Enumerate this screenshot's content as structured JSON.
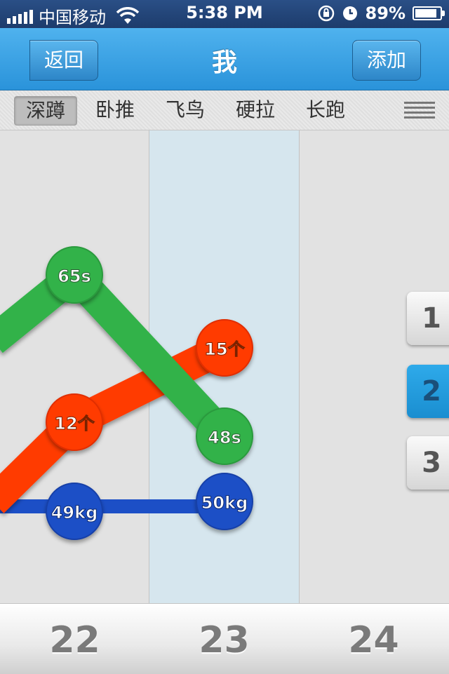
{
  "status_bar": {
    "carrier": "中国移动",
    "time": "5:38 PM",
    "battery": "89%",
    "battery_level": 0.89,
    "signal_bars": 5
  },
  "nav": {
    "back_label": "返回",
    "title": "我",
    "add_label": "添加"
  },
  "tabs": [
    {
      "label": "深蹲",
      "active": true
    },
    {
      "label": "卧推",
      "active": false
    },
    {
      "label": "飞鸟",
      "active": false
    },
    {
      "label": "硬拉",
      "active": false
    },
    {
      "label": "长跑",
      "active": false
    }
  ],
  "pages": [
    "1",
    "2",
    "3"
  ],
  "active_page": "2",
  "dates": [
    "22",
    "23",
    "24"
  ],
  "highlighted_date": "23",
  "chart_data": {
    "type": "line",
    "series": [
      {
        "color": "#33b24a",
        "points": [
          {
            "x": "22",
            "label": "65s"
          },
          {
            "x": "23",
            "label": "48s"
          }
        ]
      },
      {
        "color": "#ff3a00",
        "points": [
          {
            "x": "22",
            "label": "12个"
          },
          {
            "x": "23",
            "label": "15个"
          }
        ]
      },
      {
        "color": "#1f4fc6",
        "points": [
          {
            "x": "22",
            "label": "49kg"
          },
          {
            "x": "23",
            "label": "50kg"
          }
        ]
      }
    ]
  }
}
